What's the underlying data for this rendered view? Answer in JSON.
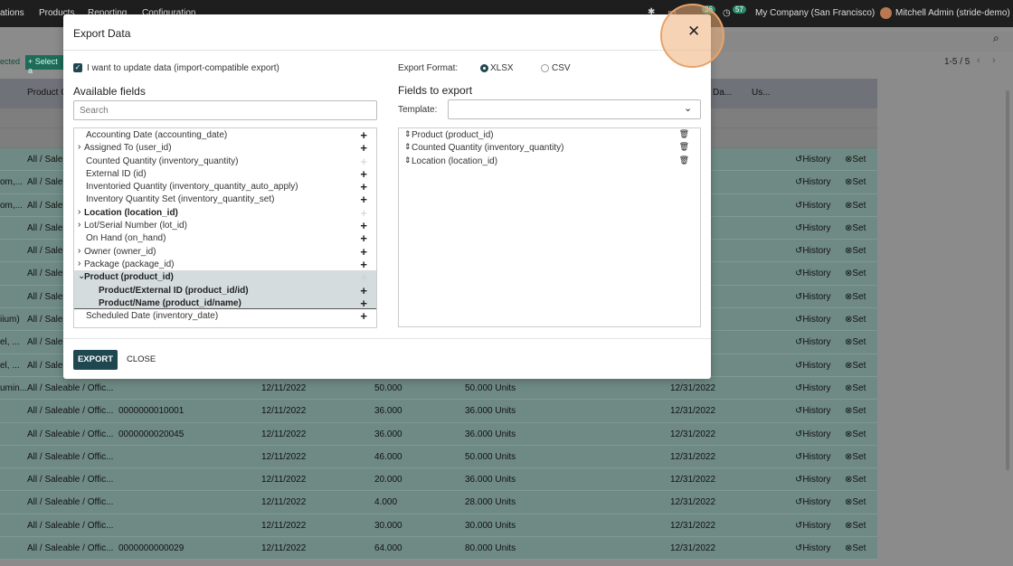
{
  "topbar": {
    "nav": [
      "ations",
      "Products",
      "Reporting",
      "Configuration"
    ],
    "activity_badge": "36",
    "clock_badge": "57",
    "company": "My Company (San Francisco)",
    "user": "Mitchell Admin (stride-demo)"
  },
  "list": {
    "selected_text": "ected",
    "select_all_label": "Select a",
    "pager": "1-5 / 5",
    "headers": [
      "Product C",
      "Da...",
      "Us..."
    ],
    "rows": [
      {
        "c0": "",
        "c1": "All / Saleab",
        "c2": "",
        "date": "",
        "qty": "",
        "counted": "",
        "sched": "3",
        "history": "History",
        "set": "Set"
      },
      {
        "c0": "om,...",
        "c1": "All / Saleab",
        "c2": "",
        "date": "",
        "qty": "",
        "counted": "",
        "sched": "022",
        "history": "History",
        "set": "Set"
      },
      {
        "c0": "om,...",
        "c1": "All / Saleab",
        "c2": "",
        "date": "",
        "qty": "",
        "counted": "",
        "sched": "022",
        "history": "History",
        "set": "Set"
      },
      {
        "c0": "",
        "c1": "All / Saleab",
        "c2": "",
        "date": "",
        "qty": "",
        "counted": "",
        "sched": "022",
        "history": "History",
        "set": "Set"
      },
      {
        "c0": "",
        "c1": "All / Saleab",
        "c2": "",
        "date": "",
        "qty": "",
        "counted": "",
        "sched": "022",
        "history": "History",
        "set": "Set"
      },
      {
        "c0": "",
        "c1": "All / Saleab",
        "c2": "",
        "date": "",
        "qty": "",
        "counted": "",
        "sched": "022",
        "history": "History",
        "set": "Set"
      },
      {
        "c0": "",
        "c1": "All / Saleab",
        "c2": "",
        "date": "",
        "qty": "",
        "counted": "",
        "sched": "022",
        "history": "History",
        "set": "Set"
      },
      {
        "c0": "iium)",
        "c1": "All / Saleab",
        "c2": "",
        "date": "",
        "qty": "",
        "counted": "",
        "sched": "022",
        "history": "History",
        "set": "Set"
      },
      {
        "c0": "el, ...",
        "c1": "All / Saleab",
        "c2": "",
        "date": "",
        "qty": "",
        "counted": "",
        "sched": "022",
        "history": "History",
        "set": "Set"
      },
      {
        "c0": "el, ...",
        "c1": "All / Saleab",
        "c2": "",
        "date": "",
        "qty": "",
        "counted": "",
        "sched": "022",
        "history": "History",
        "set": "Set"
      },
      {
        "c0": "umin...",
        "c1": "All / Saleable / Offic...",
        "c2": "",
        "date": "12/11/2022",
        "qty": "50.000",
        "counted": "50.000  Units",
        "sched": "12/31/2022",
        "history": "History",
        "set": "Set"
      },
      {
        "c0": "",
        "c1": "All / Saleable / Offic...",
        "c2": "0000000010001",
        "date": "12/11/2022",
        "qty": "36.000",
        "counted": "36.000  Units",
        "sched": "12/31/2022",
        "history": "History",
        "set": "Set"
      },
      {
        "c0": "",
        "c1": "All / Saleable / Offic...",
        "c2": "0000000020045",
        "date": "12/11/2022",
        "qty": "36.000",
        "counted": "36.000  Units",
        "sched": "12/31/2022",
        "history": "History",
        "set": "Set"
      },
      {
        "c0": "",
        "c1": "All / Saleable / Offic...",
        "c2": "",
        "date": "12/11/2022",
        "qty": "46.000",
        "counted": "50.000  Units",
        "sched": "12/31/2022",
        "history": "History",
        "set": "Set"
      },
      {
        "c0": "",
        "c1": "All / Saleable / Offic...",
        "c2": "",
        "date": "12/11/2022",
        "qty": "20.000",
        "counted": "36.000  Units",
        "sched": "12/31/2022",
        "history": "History",
        "set": "Set"
      },
      {
        "c0": "",
        "c1": "All / Saleable / Offic...",
        "c2": "",
        "date": "12/11/2022",
        "qty": "4.000",
        "counted": "28.000  Units",
        "sched": "12/31/2022",
        "history": "History",
        "set": "Set"
      },
      {
        "c0": "",
        "c1": "All / Saleable / Offic...",
        "c2": "",
        "date": "12/11/2022",
        "qty": "30.000",
        "counted": "30.000  Units",
        "sched": "12/31/2022",
        "history": "History",
        "set": "Set"
      },
      {
        "c0": "",
        "c1": "All / Saleable / Offic...",
        "c2": "0000000000029",
        "date": "12/11/2022",
        "qty": "64.000",
        "counted": "80.000  Units",
        "sched": "12/31/2022",
        "history": "History",
        "set": "Set"
      }
    ]
  },
  "modal": {
    "title": "Export Data",
    "close_glyph": "✕",
    "import_compatible_label": "I want to update data (import-compatible export)",
    "available_heading": "Available fields",
    "search_placeholder": "Search",
    "export_format_label": "Export Format:",
    "format_xlsx": "XLSX",
    "format_csv": "CSV",
    "fields_heading": "Fields to export",
    "template_label": "Template:",
    "template_value": "",
    "available_fields": [
      {
        "label": "Accounting Date (accounting_date)",
        "expandable": false,
        "bold": false,
        "added": false
      },
      {
        "label": "Assigned To (user_id)",
        "expandable": true,
        "bold": false,
        "added": false
      },
      {
        "label": "Counted Quantity (inventory_quantity)",
        "expandable": false,
        "bold": false,
        "added": true
      },
      {
        "label": "External ID (id)",
        "expandable": false,
        "bold": false,
        "added": false
      },
      {
        "label": "Inventoried Quantity (inventory_quantity_auto_apply)",
        "expandable": false,
        "bold": false,
        "added": false
      },
      {
        "label": "Inventory Quantity Set (inventory_quantity_set)",
        "expandable": false,
        "bold": false,
        "added": false
      },
      {
        "label": "Location (location_id)",
        "expandable": true,
        "bold": true,
        "added": true
      },
      {
        "label": "Lot/Serial Number (lot_id)",
        "expandable": true,
        "bold": false,
        "added": false
      },
      {
        "label": "On Hand (on_hand)",
        "expandable": false,
        "bold": false,
        "added": false
      },
      {
        "label": "Owner (owner_id)",
        "expandable": true,
        "bold": false,
        "added": false
      },
      {
        "label": "Package (package_id)",
        "expandable": true,
        "bold": false,
        "added": false
      },
      {
        "label": "Product (product_id)",
        "expandable": true,
        "bold": true,
        "added": true,
        "open": true
      },
      {
        "label": "Product/External ID (product_id/id)",
        "expandable": false,
        "bold": true,
        "added": false,
        "child": true
      },
      {
        "label": "Product/Name (product_id/name)",
        "expandable": false,
        "bold": true,
        "added": false,
        "child": true
      },
      {
        "label": "Scheduled Date (inventory_date)",
        "expandable": false,
        "bold": false,
        "added": false
      }
    ],
    "export_fields": [
      "Product (product_id)",
      "Counted Quantity (inventory_quantity)",
      "Location (location_id)"
    ],
    "export_button": "EXPORT",
    "close_button": "CLOSE"
  }
}
